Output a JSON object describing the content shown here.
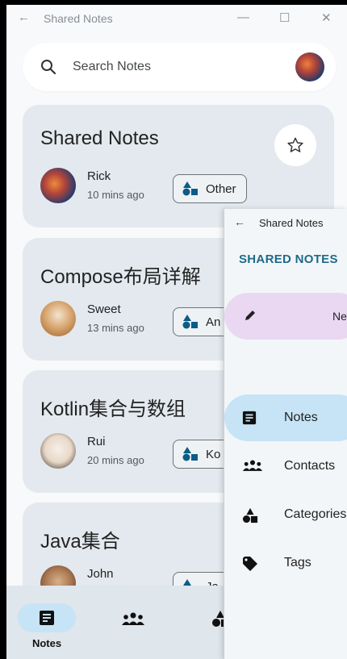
{
  "window": {
    "title": "Shared Notes",
    "controls": [
      "—",
      "☐",
      "✕"
    ]
  },
  "search": {
    "placeholder": "Search Notes"
  },
  "notes": [
    {
      "title": "Shared Notes",
      "author": "Rick",
      "time": "10 mins ago",
      "category": "Other",
      "starred": false
    },
    {
      "title": "Compose布局详解",
      "author": "Sweet",
      "time": "13 mins ago",
      "category": "An"
    },
    {
      "title": "Kotlin集合与数组",
      "author": "Rui",
      "time": "20 mins ago",
      "category": "Ko"
    },
    {
      "title": "Java集合",
      "author": "John",
      "time": "",
      "category": "Ja"
    }
  ],
  "bottom_nav": {
    "items": [
      {
        "label": "Notes",
        "active": true
      },
      {
        "label": "",
        "active": false
      },
      {
        "label": "",
        "active": false
      }
    ]
  },
  "drawer": {
    "window_title": "Shared Notes",
    "title": "SHARED NOTES",
    "new_note_label": "Ne",
    "items": [
      {
        "label": "Notes",
        "icon": "notes-icon",
        "active": true
      },
      {
        "label": "Contacts",
        "icon": "contacts-icon",
        "active": false
      },
      {
        "label": "Categories",
        "icon": "categories-icon",
        "active": false
      },
      {
        "label": "Tags",
        "icon": "tag-icon",
        "active": false
      }
    ]
  },
  "colors": {
    "card_bg": "#e3e9ee",
    "accent_pill": "#c6e4f5",
    "drawer_title": "#1e6a8a",
    "new_note_bg": "#ead8f2"
  }
}
